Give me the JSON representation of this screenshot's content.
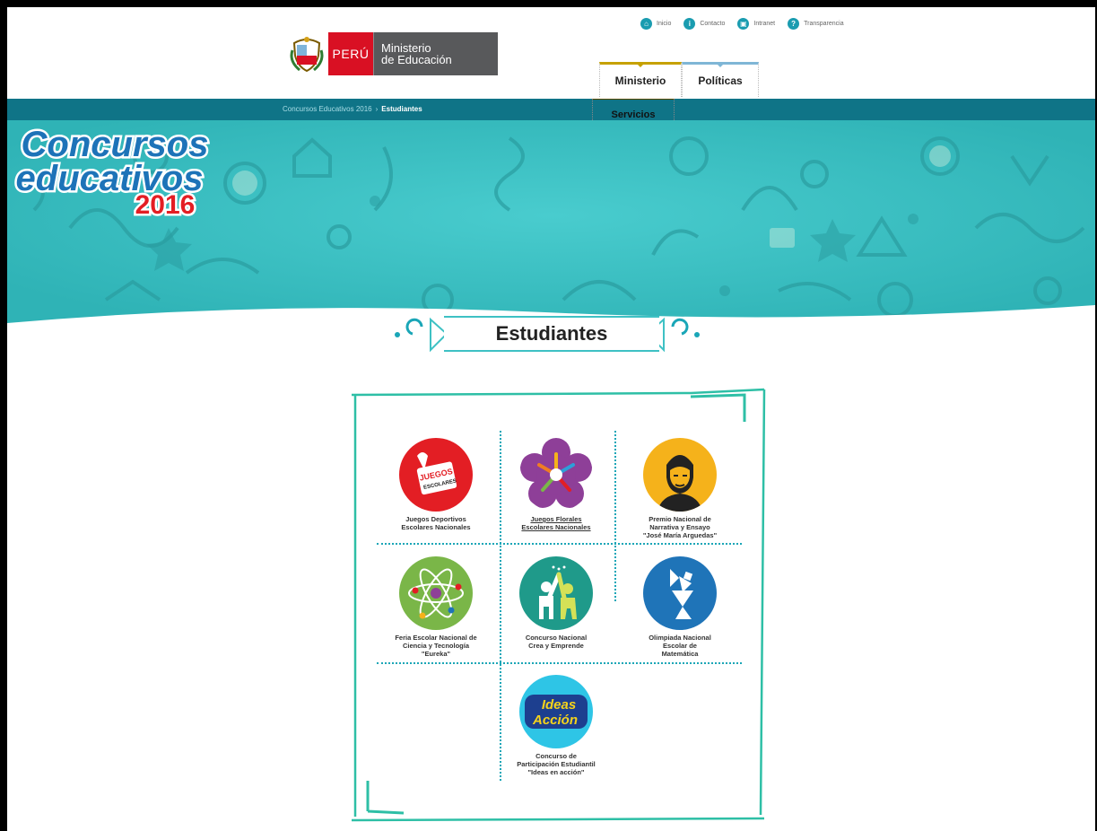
{
  "header": {
    "logo": {
      "country": "PERÚ",
      "ministry_line1": "Ministerio",
      "ministry_line2": "de Educación"
    },
    "top_links": [
      {
        "label": "Inicio",
        "icon": "home-icon"
      },
      {
        "label": "Contacto",
        "icon": "info-icon"
      },
      {
        "label": "Intranet",
        "icon": "lock-icon"
      },
      {
        "label": "Transparencia",
        "icon": "transparency-icon"
      }
    ],
    "nav": [
      {
        "label": "Ministerio"
      },
      {
        "label": "Políticas"
      },
      {
        "label": "Servicios"
      }
    ]
  },
  "breadcrumb": {
    "parent": "Concursos Educativos 2016",
    "separator": "›",
    "current": "Estudiantes"
  },
  "banner": {
    "line1": "Concursos",
    "line2": "educativos",
    "year": "2016"
  },
  "section": {
    "title": "Estudiantes"
  },
  "contests": [
    {
      "name": "Juegos Deportivos Escolares Nacionales",
      "line1": "Juegos Deportivos",
      "line2": "Escolares Nacionales",
      "line3": "",
      "color": "#e31e24",
      "logo_text": "JUEGOS deportivos ESCOLARES nacionales"
    },
    {
      "name": "Juegos Florales Escolares Nacionales",
      "line1": "Juegos Florales",
      "line2": "Escolares Nacionales",
      "line3": "",
      "color": "#8e3f98"
    },
    {
      "name": "Premio Nacional de Narrativa y Ensayo José María Arguedas",
      "line1": "Premio Nacional de",
      "line2": "Narrativa y Ensayo",
      "line3": "\"José María Arguedas\"",
      "color": "#f5b21b"
    },
    {
      "name": "Feria Escolar Nacional de Ciencia y Tecnología Eureka",
      "line1": "Feria Escolar Nacional de",
      "line2": "Ciencia y Tecnología",
      "line3": "\"Eureka\"",
      "color": "#7ab648"
    },
    {
      "name": "Concurso Nacional Crea y Emprende",
      "line1": "Concurso Nacional",
      "line2": "Crea y Emprende",
      "line3": "",
      "color": "#1f9a8a"
    },
    {
      "name": "Olimpiada Nacional Escolar de Matemática",
      "line1": "Olimpiada Nacional",
      "line2": "Escolar de",
      "line3": "Matemática",
      "color": "#1f74b8"
    },
    {
      "name": "Concurso de Participación Estudiantil Ideas en acción",
      "line1": "Concurso de",
      "line2": "Participación Estudiantil",
      "line3": "\"Ideas en acción\"",
      "color": "#2ec5e6",
      "logo_line1": "Ideas",
      "logo_line2": "Acción"
    }
  ]
}
